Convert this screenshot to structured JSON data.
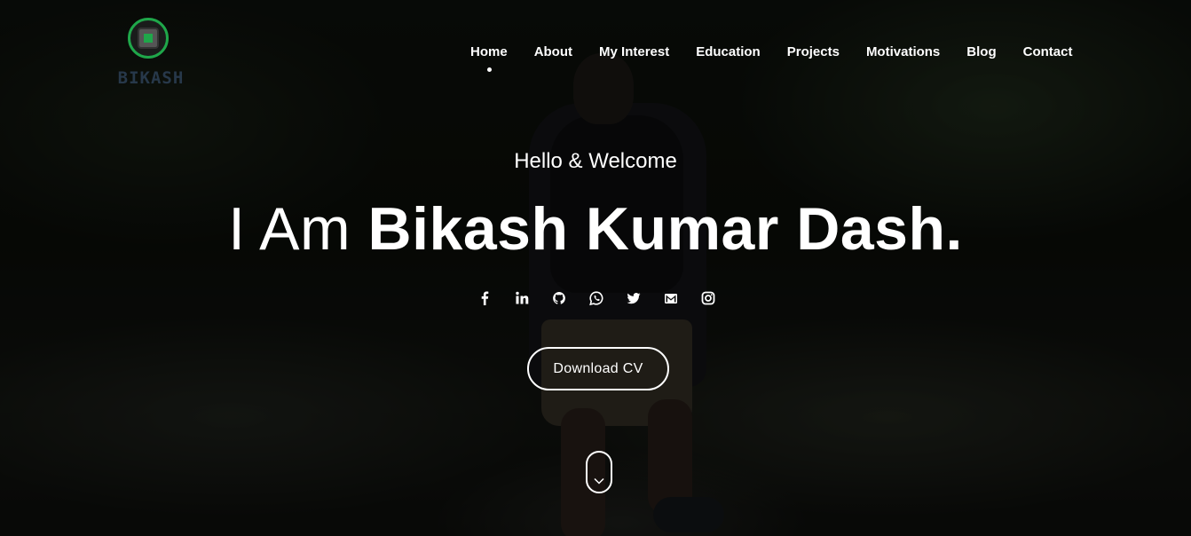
{
  "brand": {
    "name": "BIKASH",
    "accent": "#1fa74a",
    "text_color": "#27384a"
  },
  "nav": {
    "items": [
      {
        "label": "Home",
        "active": true
      },
      {
        "label": "About"
      },
      {
        "label": "My Interest"
      },
      {
        "label": "Education"
      },
      {
        "label": "Projects"
      },
      {
        "label": "Motivations"
      },
      {
        "label": "Blog"
      },
      {
        "label": "Contact"
      }
    ]
  },
  "hero": {
    "greeting": "Hello & Welcome",
    "headline_prefix": "I Am",
    "headline_name": "Bikash Kumar Dash.",
    "cv_button": "Download CV"
  },
  "socials": [
    {
      "icon": "facebook-icon"
    },
    {
      "icon": "linkedin-icon"
    },
    {
      "icon": "github-icon"
    },
    {
      "icon": "whatsapp-icon"
    },
    {
      "icon": "twitter-icon"
    },
    {
      "icon": "gmail-icon"
    },
    {
      "icon": "instagram-icon"
    }
  ],
  "scroll_indicator": {
    "icon": "chevron-down-icon"
  }
}
